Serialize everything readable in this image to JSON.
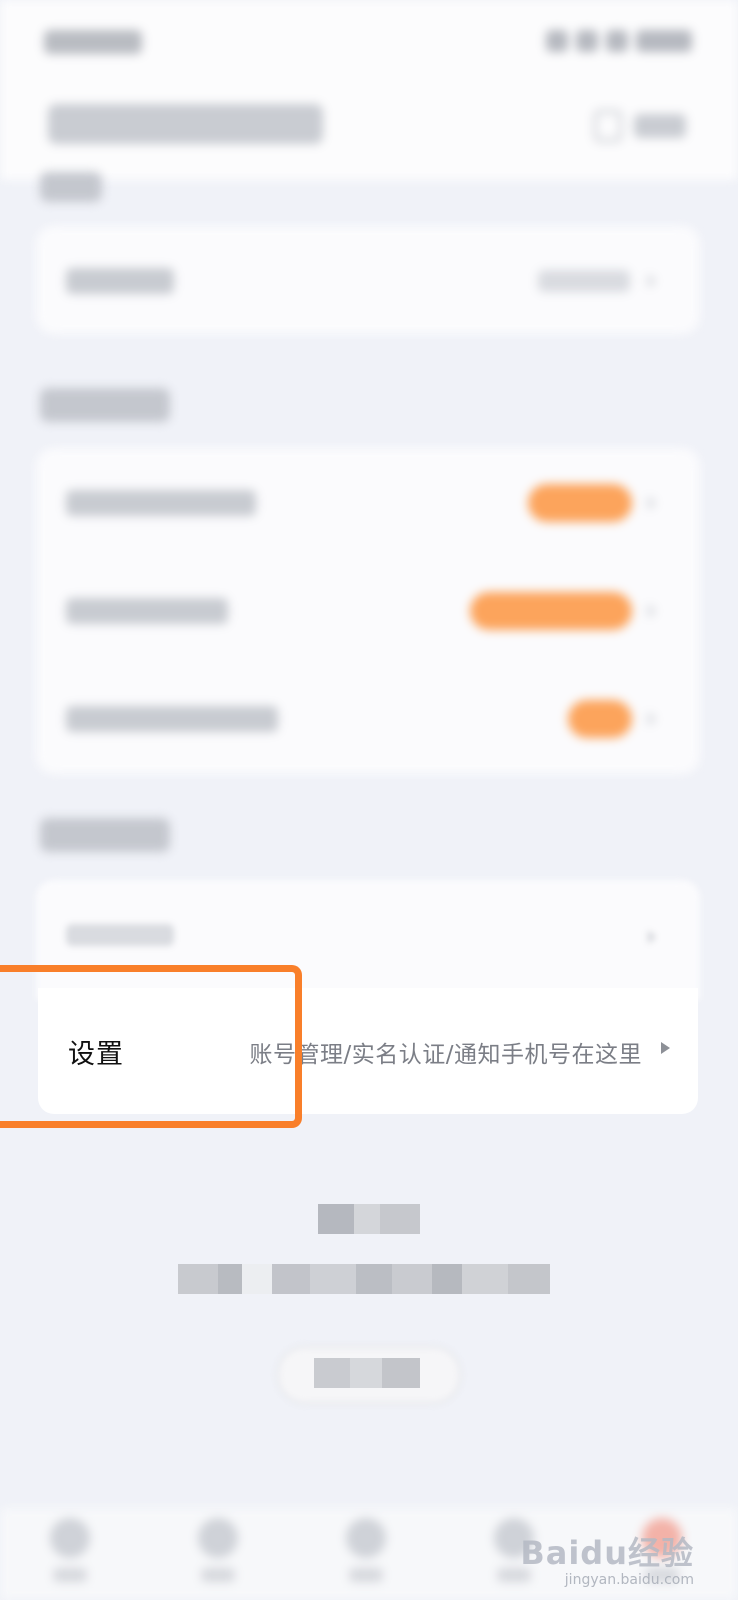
{
  "settings": {
    "label": "设置",
    "description": "账号管理/实名认证/通知手机号在这里"
  },
  "watermark": {
    "brand": "Baidu经验",
    "url": "jingyan.baidu.com"
  },
  "colors": {
    "highlight": "#f97f2a",
    "badge": "#fca45c",
    "background": "#f0f2f8"
  }
}
